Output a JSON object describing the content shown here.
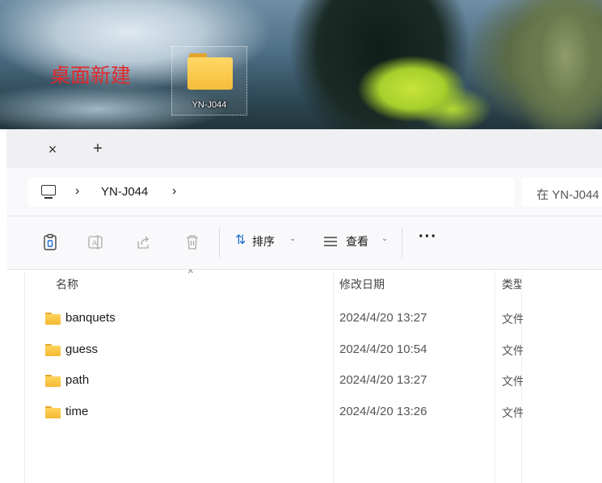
{
  "desktop": {
    "label_text": "桌面新建",
    "label_color": "#e0282c",
    "folder_icon_name": "YN-J044"
  },
  "explorer": {
    "tabbar": {
      "close_glyph": "×",
      "new_tab_glyph": "+"
    },
    "address": {
      "separator": "›",
      "current_folder": "YN-J044",
      "search_placeholder": "在 YN-J044"
    },
    "toolbar": {
      "sort_label": "排序",
      "view_label": "查看",
      "more_label": "···",
      "dropdown_glyph": "⌄",
      "sort_icon": "⇅"
    },
    "columns": {
      "name": "名称",
      "modified": "修改日期",
      "type": "类型"
    },
    "files": [
      {
        "name": "banquets",
        "modified": "2024/4/20 13:27",
        "type": "文件夹"
      },
      {
        "name": "guess",
        "modified": "2024/4/20 10:54",
        "type": "文件夹"
      },
      {
        "name": "path",
        "modified": "2024/4/20 13:27",
        "type": "文件夹"
      },
      {
        "name": "time",
        "modified": "2024/4/20 13:26",
        "type": "文件夹"
      }
    ]
  }
}
